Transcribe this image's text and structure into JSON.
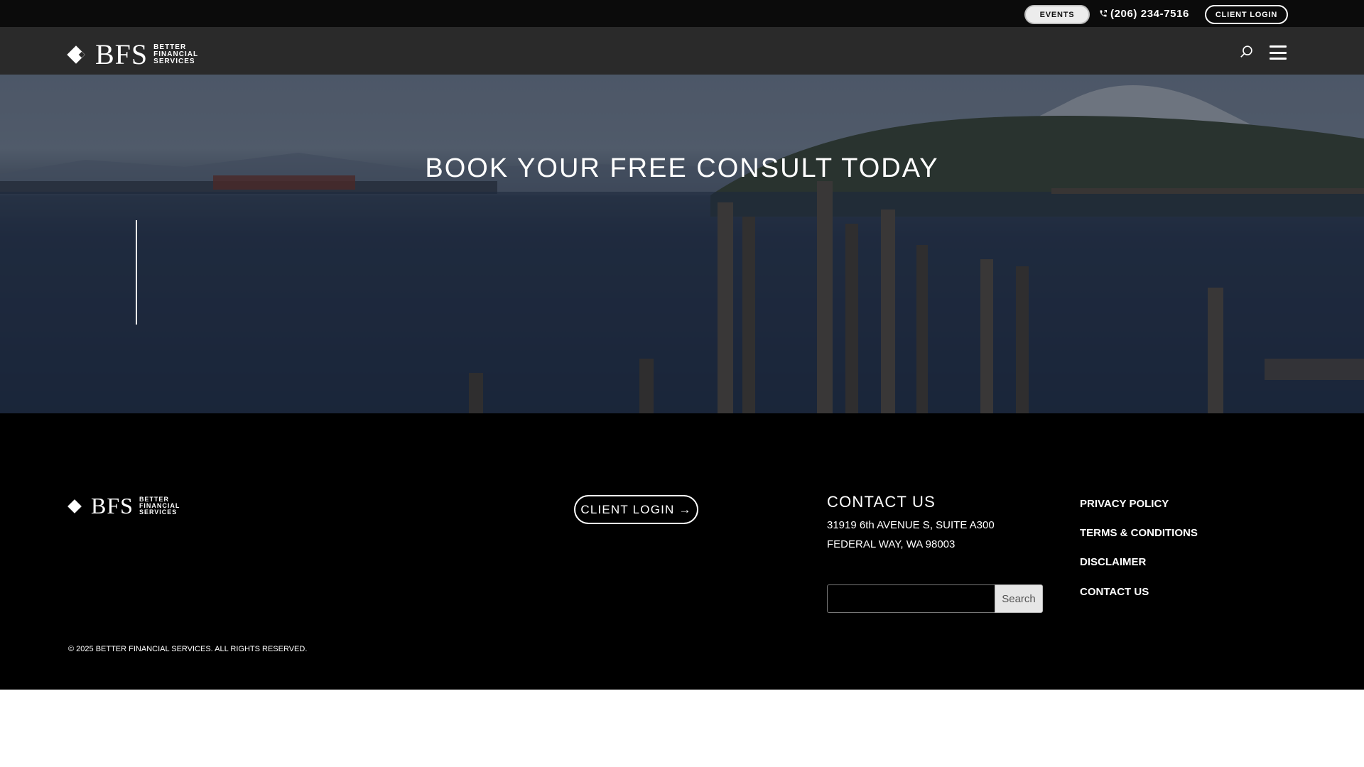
{
  "topbar": {
    "events_label": "EVENTS",
    "phone": "(206) 234-7516",
    "client_login_label": "CLIENT LOGIN"
  },
  "brand": {
    "letters": "BFS",
    "line1": "BETTER",
    "line2": "FINANCIAL",
    "line3": "SERVICES"
  },
  "nav": {
    "search_icon": "search-icon",
    "menu_icon": "hamburger-menu-icon"
  },
  "hero": {
    "title": "BOOK YOUR FREE CONSULT TODAY"
  },
  "footer": {
    "client_login_label": "CLIENT LOGIN →",
    "contact_title": "CONTACT US",
    "address_line1": "31919 6th AVENUE S, SUITE A300",
    "address_line2": "FEDERAL WAY, WA 98003",
    "search_placeholder": "",
    "search_button": "Search",
    "links": [
      "PRIVACY POLICY",
      "TERMS & CONDITIONS",
      "DISCLAIMER",
      "CONTACT US"
    ],
    "copyright": "© 2025 BETTER FINANCIAL SERVICES. ALL RIGHTS RESERVED."
  },
  "colors": {
    "topbar_bg": "#0b0b0b",
    "navbar_bg": "#2a2a2a",
    "footer_bg": "#000000",
    "text": "#ffffff"
  }
}
